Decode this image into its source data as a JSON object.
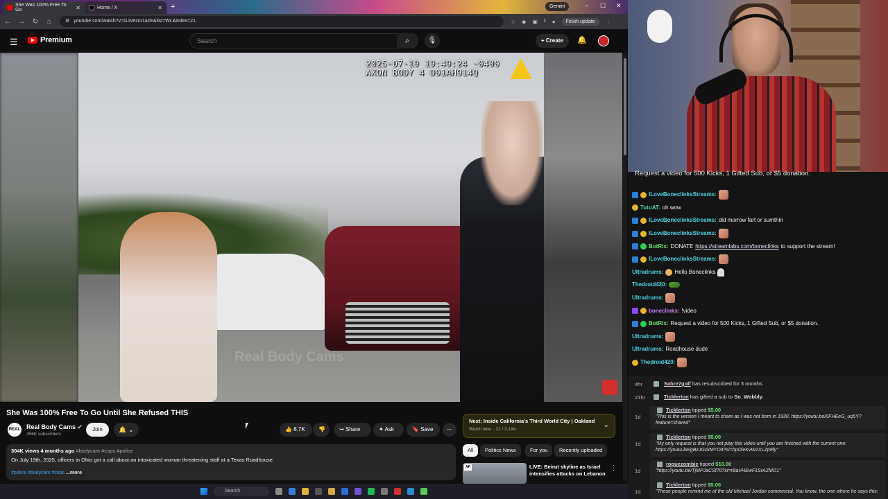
{
  "browser": {
    "tabs": [
      {
        "label": "She Was 100% Free To Go",
        "active": true
      },
      {
        "label": "Home / X",
        "active": false
      }
    ],
    "gemini_label": "Gemini",
    "url": "youtube.com/watch?v=GJVeznr1azE&list=WL&index=21",
    "finish_update": "Finish update"
  },
  "youtube": {
    "logo_text": "Premium",
    "search_placeholder": "Search",
    "create_label": "Create",
    "video": {
      "timestamp_line1": "2025-07-19 19:49:24 -0400",
      "timestamp_line2": "AXON BODY 4 D01AH914Q",
      "watermark": "Real Body Cams",
      "title": "She Was 100% Free To Go Until She Refused THIS",
      "channel_name": "Real Body Cams",
      "channel_avatar_text": "REAL",
      "subscribers": "356K subscribers",
      "join_label": "Join",
      "likes": "8.7K",
      "share_label": "Share",
      "ask_label": "Ask",
      "save_label": "Save"
    },
    "description": {
      "views": "304K views",
      "age": "4 months ago",
      "hashtags_top": "#bodycam #cops #police",
      "text": "On July 19th, 2025, officers in Ohio got a call about an intoxicated woman threatening staff at a Texas Roadhouse.",
      "hashtags_bottom": "#police #bodycam #cops",
      "more_label": "...more"
    },
    "up_next": {
      "label": "Next:",
      "title": "Inside California's Third World City | Oakland",
      "sub": "Watch later - 21 / 3,184"
    },
    "chips": [
      "All",
      "Politics News",
      "For you",
      "Recently uploaded"
    ],
    "rec": {
      "badge": "AP",
      "title": "LIVE: Beirut skyline as Israel intensifies attacks on Lebanon"
    }
  },
  "taskbar": {
    "search_label": "Search"
  },
  "stream": {
    "banner": "Request a video for 500 Kicks, 1 Gifted Sub, or $5 donation.",
    "chat": [
      {
        "user": "ILoveBoneclinksStreams:",
        "color": "#4ad6e8",
        "text": "",
        "badges": [
          "b1",
          "b3"
        ],
        "emote": "face"
      },
      {
        "user": "TutuAT:",
        "color": "#4ad6a0",
        "text": "oh wow",
        "badges": [
          "b3"
        ],
        "emote": ""
      },
      {
        "user": "ILoveBoneclinksStreams:",
        "color": "#4ad6e8",
        "text": "did morrow fart or sumthin",
        "badges": [
          "b1",
          "b3"
        ],
        "emote": ""
      },
      {
        "user": "ILoveBoneclinksStreams:",
        "color": "#4ad6e8",
        "text": "",
        "badges": [
          "b1",
          "b3"
        ],
        "emote": "face"
      },
      {
        "user": "BotRix:",
        "color": "#6ee36e",
        "text": "DONATE ",
        "link": "https://streamlabs.com/boneclinks",
        "after": " to support the stream!",
        "badges": [
          "b1",
          "b2"
        ],
        "emote": ""
      },
      {
        "user": "ILoveBoneclinksStreams:",
        "color": "#4ad6e8",
        "text": "",
        "badges": [
          "b1",
          "b3"
        ],
        "emote": "face"
      },
      {
        "user": "Ultradrums:",
        "color": "#4ad6e8",
        "text": "Hello Boneclinks",
        "badges": [],
        "emote": "ghost",
        "pre_emote": "smile"
      },
      {
        "user": "Thedroid420:",
        "color": "#4ad6e8",
        "text": "",
        "badges": [],
        "emote": "frog"
      },
      {
        "user": "Ultradrums:",
        "color": "#4ad6e8",
        "text": "",
        "badges": [],
        "emote": "face"
      },
      {
        "user": "boneclinks:",
        "color": "#c77dff",
        "text": "!video",
        "badges": [
          "b4",
          "b3"
        ],
        "emote": ""
      },
      {
        "user": "BotRix:",
        "color": "#6ee36e",
        "text": "Request a video for 500 Kicks, 1 Gifted Sub, or $5 donation.",
        "badges": [
          "b1",
          "b2"
        ],
        "emote": ""
      },
      {
        "user": "Ultradrums:",
        "color": "#4ad6e8",
        "text": "",
        "badges": [],
        "emote": "face"
      },
      {
        "user": "Ultradrums:",
        "color": "#4ad6e8",
        "text": "Roadhouse dude",
        "badges": [],
        "emote": ""
      },
      {
        "user": "Thedroid420:",
        "color": "#4ad6e8",
        "text": "",
        "badges": [
          "b3"
        ],
        "emote": "face"
      }
    ],
    "events": [
      {
        "time": "4hr",
        "name": "Sabre7golf",
        "text": " has resubscribed for 3 months"
      },
      {
        "time": "21hr",
        "name": "Ticklerton",
        "text": " has gifted a sub to ",
        "target": "So_Wobbly",
        "tail": "."
      },
      {
        "time": "1d",
        "name": "Ticklerton",
        "text": " tipped ",
        "amount": "$5.00",
        "quote": "\"This is the version I meant to share as I was not born in 1930. https://youtu.be/0FHEeG_uq5Y?feature=shared\""
      },
      {
        "time": "1d",
        "name": "Ticklerton",
        "text": " tipped ",
        "amount": "$5.00",
        "quote": "\"My only request is that you not play this video until you are finished with the current one: https://youtu.be/gBzJGckMYO4?si=hpOieKvW2XLZp9fy\""
      },
      {
        "time": "1d",
        "name": "roguezombie",
        "text": " tipped ",
        "amount": "$10.00",
        "quote": "\"https://youtu.be/TjMPJaCSf70?si=rBaVHEwF1SrAZMO1\""
      },
      {
        "time": "1d",
        "name": "Ticklerton",
        "text": " tipped ",
        "amount": "$5.00",
        "quote": "\"These people remind me of the old Michael Jordan commercial. You know, the one where he says this:"
      }
    ]
  }
}
